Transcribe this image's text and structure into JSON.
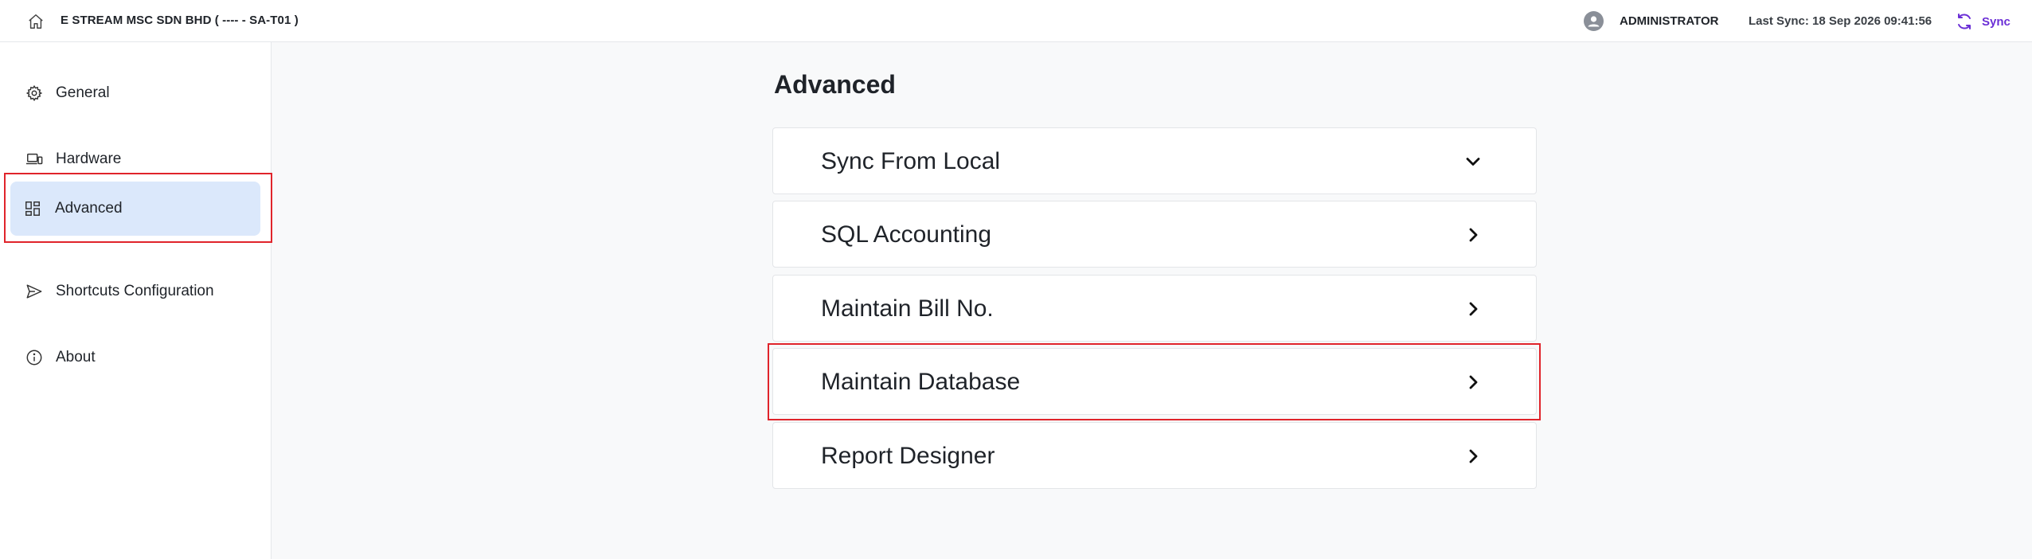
{
  "header": {
    "company": "E STREAM MSC SDN BHD ( ---- - SA-T01 )",
    "user": "ADMINISTRATOR",
    "last_sync": "Last Sync: 18 Sep 2026 09:41:56",
    "sync_label": "Sync",
    "accent_color": "#6b2fd6"
  },
  "sidebar": {
    "items": [
      {
        "label": "General",
        "icon": "gear-icon"
      },
      {
        "label": "Hardware",
        "icon": "devices-icon"
      },
      {
        "label": "Advanced",
        "icon": "grid-icon",
        "active": true
      },
      {
        "label": "Shortcuts Configuration",
        "icon": "send-icon"
      },
      {
        "label": "About",
        "icon": "info-icon"
      }
    ]
  },
  "main": {
    "title": "Advanced",
    "rows": [
      {
        "label": "Sync From Local",
        "icon": "chevron-down-icon"
      },
      {
        "label": "SQL Accounting",
        "icon": "chevron-right-icon"
      },
      {
        "label": "Maintain Bill No.",
        "icon": "chevron-right-icon"
      },
      {
        "label": "Maintain Database",
        "icon": "chevron-right-icon",
        "highlighted": true
      },
      {
        "label": "Report Designer",
        "icon": "chevron-right-icon"
      }
    ]
  }
}
